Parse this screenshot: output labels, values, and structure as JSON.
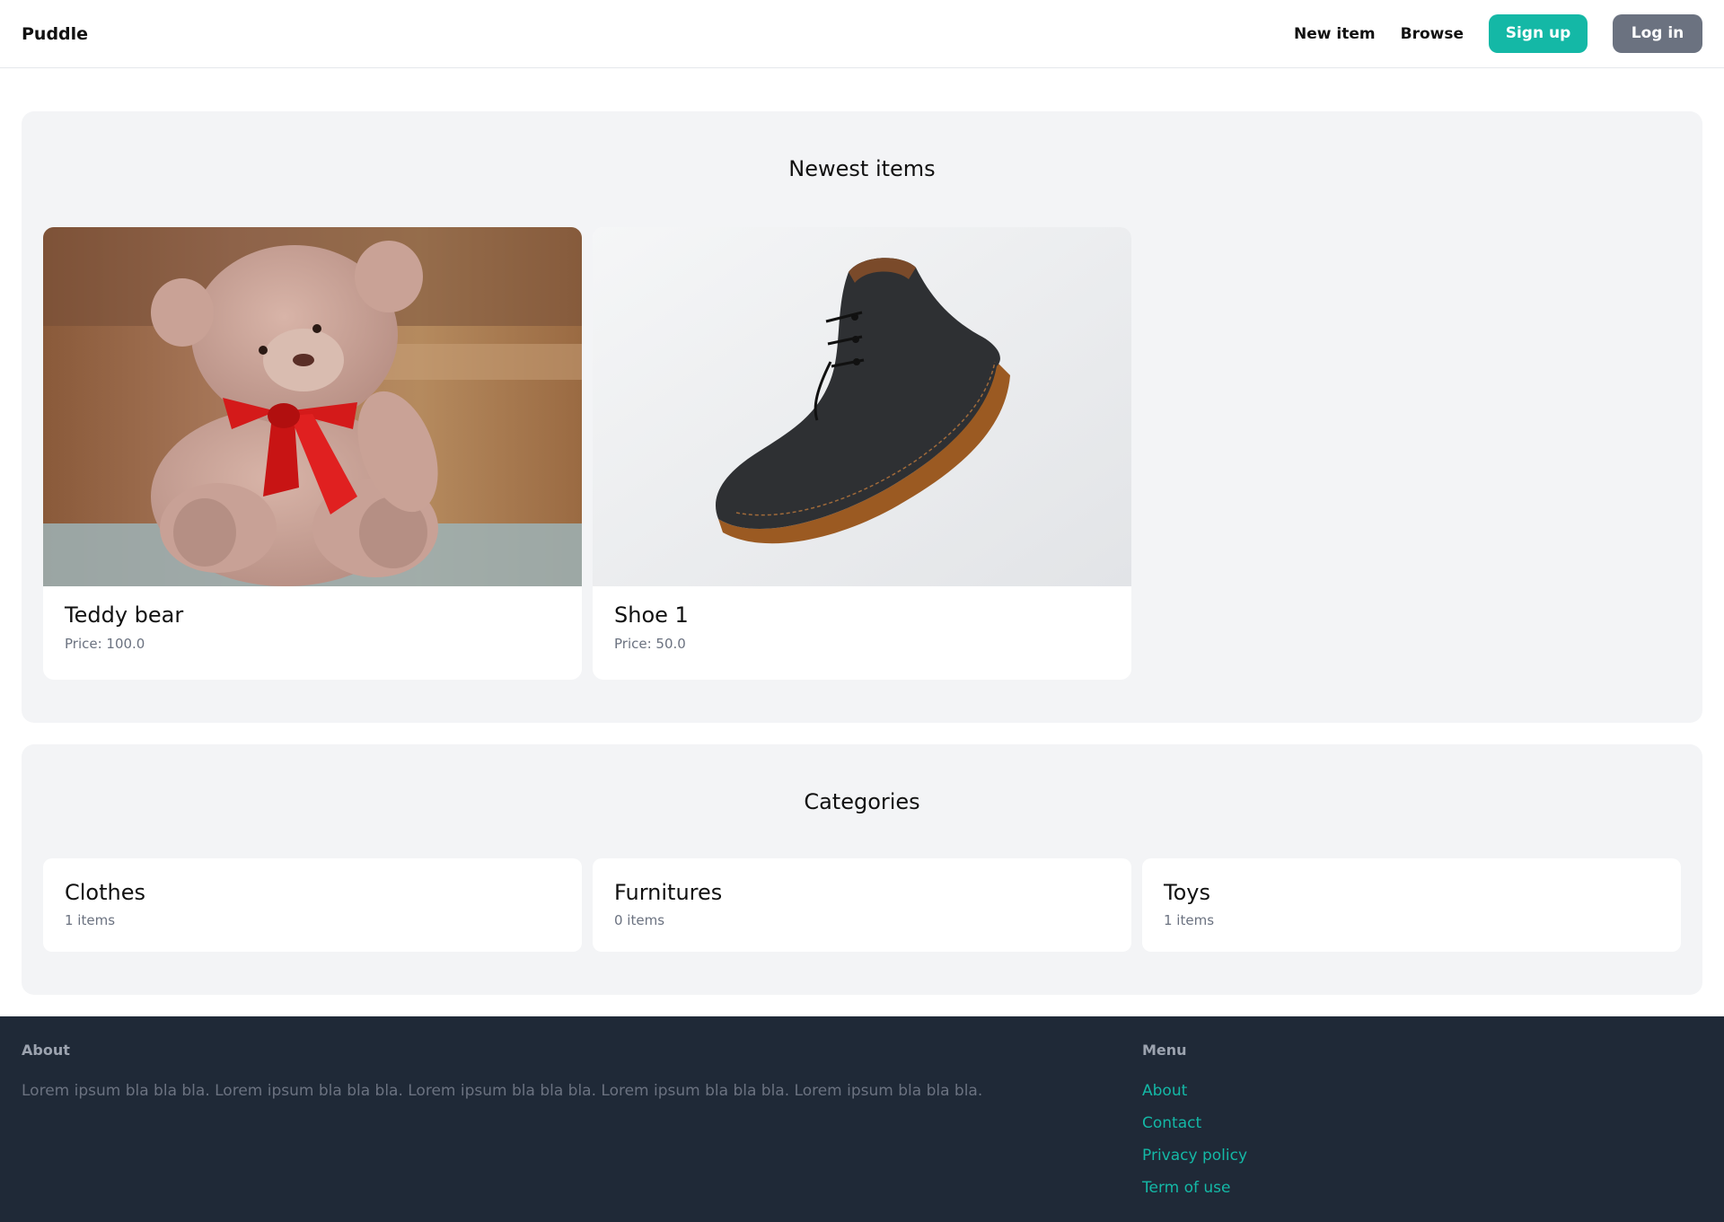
{
  "nav": {
    "logo": "Puddle",
    "links": [
      {
        "label": "New item"
      },
      {
        "label": "Browse"
      }
    ],
    "signup_label": "Sign up",
    "login_label": "Log in",
    "colors": {
      "signup": "#14b8a6",
      "login": "#6b7280"
    }
  },
  "newest": {
    "title": "Newest items",
    "items": [
      {
        "name": "Teddy bear",
        "price": "Price: 100.0",
        "image": "teddy-bear-photo"
      },
      {
        "name": "Shoe 1",
        "price": "Price: 50.0",
        "image": "shoe-photo"
      }
    ]
  },
  "categories": {
    "title": "Categories",
    "items": [
      {
        "name": "Clothes",
        "count": "1 items"
      },
      {
        "name": "Furnitures",
        "count": "0 items"
      },
      {
        "name": "Toys",
        "count": "1 items"
      }
    ]
  },
  "footer": {
    "about_heading": "About",
    "about_text": "Lorem ipsum bla bla bla. Lorem ipsum bla bla bla. Lorem ipsum bla bla bla. Lorem ipsum bla bla bla. Lorem ipsum bla bla bla.",
    "menu_heading": "Menu",
    "menu_links": [
      {
        "label": "About"
      },
      {
        "label": "Contact"
      },
      {
        "label": "Privacy policy"
      },
      {
        "label": "Term of use"
      }
    ],
    "colors": {
      "background": "#1f2937",
      "link": "#14b8a6"
    }
  }
}
